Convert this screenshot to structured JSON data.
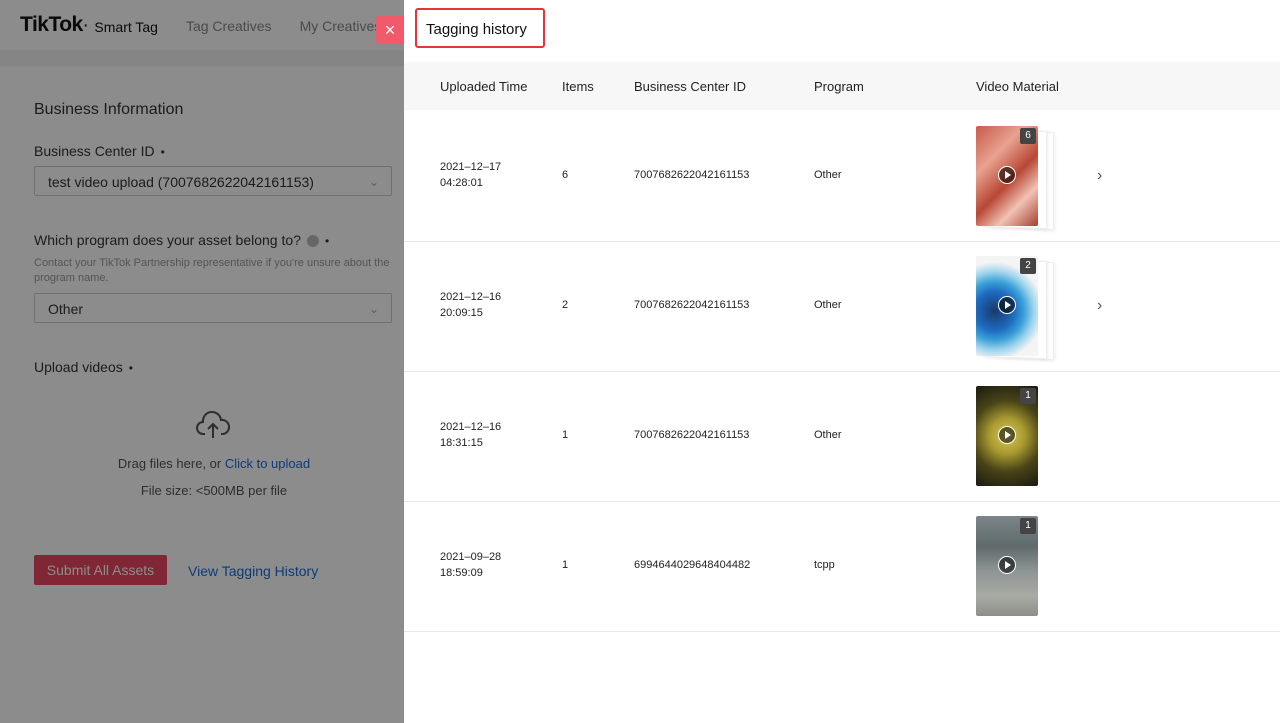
{
  "header": {
    "logo": "TikTok",
    "logo_dot": "·",
    "product": "Smart Tag",
    "nav": [
      "Tag Creatives",
      "My Creatives"
    ]
  },
  "form": {
    "section_title": "Business Information",
    "bc_label": "Business Center ID",
    "bc_value": "test video upload (7007682622042161153)",
    "program_label": "Which program does your asset belong to?",
    "program_help": "Contact your TikTok Partnership representative if you're unsure about the program name.",
    "program_value": "Other",
    "upload_label": "Upload videos",
    "drag_text": "Drag files here, or ",
    "click_upload": "Click to upload",
    "file_size": "File size: <500MB per file",
    "submit": "Submit All Assets",
    "view_history": "View Tagging History",
    "required_mark": "•"
  },
  "drawer": {
    "title": "Tagging history",
    "close": "×",
    "columns": [
      "Uploaded Time",
      "Items",
      "Business Center ID",
      "Program",
      "Video Material"
    ],
    "rows": [
      {
        "date": "2021–12–17",
        "time": "04:28:01",
        "items": "6",
        "bc_id": "7007682622042161153",
        "program": "Other",
        "count": "6"
      },
      {
        "date": "2021–12–16",
        "time": "20:09:15",
        "items": "2",
        "bc_id": "7007682622042161153",
        "program": "Other",
        "count": "2"
      },
      {
        "date": "2021–12–16",
        "time": "18:31:15",
        "items": "1",
        "bc_id": "7007682622042161153",
        "program": "Other",
        "count": "1"
      },
      {
        "date": "2021–09–28",
        "time": "18:59:09",
        "items": "1",
        "bc_id": "6994644029648404482",
        "program": "tcpp",
        "count": "1"
      }
    ]
  },
  "colors": {
    "accent": "#e94560",
    "link": "#1a6cdc",
    "highlight_border": "#e5343a"
  }
}
